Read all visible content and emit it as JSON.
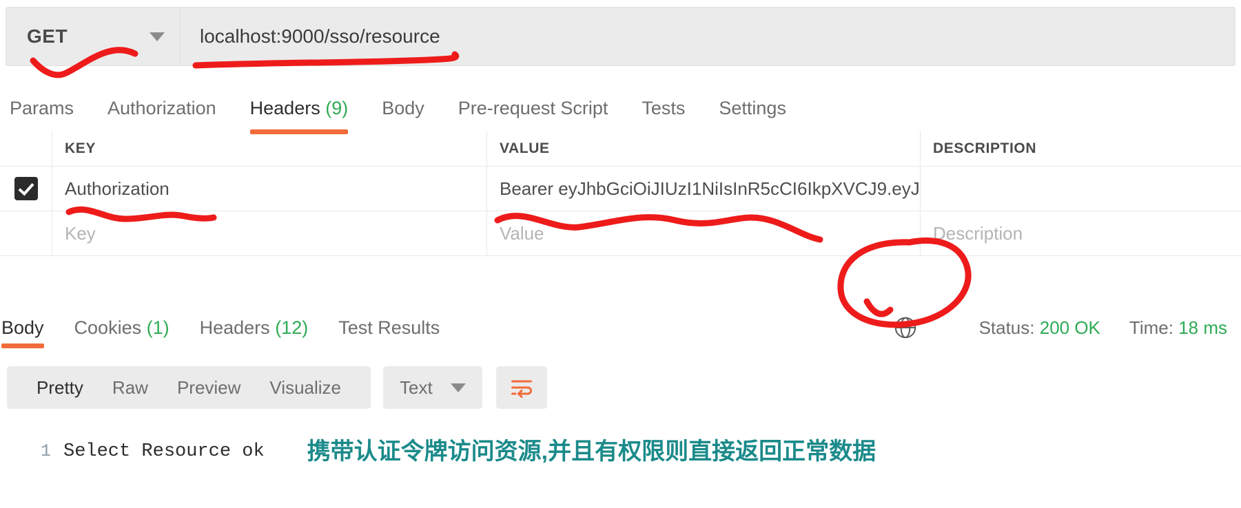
{
  "request": {
    "method": "GET",
    "url": "localhost:9000/sso/resource",
    "method_dropdown_icon": "chevron-down-icon",
    "tabs": [
      {
        "label": "Params",
        "count": "",
        "active": false
      },
      {
        "label": "Authorization",
        "count": "",
        "active": false
      },
      {
        "label": "Headers",
        "count": "(9)",
        "active": true
      },
      {
        "label": "Body",
        "count": "",
        "active": false
      },
      {
        "label": "Pre-request Script",
        "count": "",
        "active": false
      },
      {
        "label": "Tests",
        "count": "",
        "active": false
      },
      {
        "label": "Settings",
        "count": "",
        "active": false
      }
    ]
  },
  "headers_table": {
    "columns": [
      "KEY",
      "VALUE",
      "DESCRIPTION"
    ],
    "rows": [
      {
        "checked": true,
        "key": "Authorization",
        "value": "Bearer eyJhbGciOiJIUzI1NiIsInR5cCI6IkpXVCJ9.eyJ...",
        "description": ""
      }
    ],
    "placeholders": {
      "key": "Key",
      "value": "Value",
      "description": "Description"
    }
  },
  "response": {
    "tabs": [
      {
        "label": "Body",
        "count": "",
        "active": true
      },
      {
        "label": "Cookies",
        "count": "(1)",
        "active": false
      },
      {
        "label": "Headers",
        "count": "(12)",
        "active": false
      },
      {
        "label": "Test Results",
        "count": "",
        "active": false
      }
    ],
    "globe_icon": "globe-icon",
    "status_label": "Status:",
    "status_value": "200 OK",
    "time_label": "Time:",
    "time_value": "18 ms",
    "format_options": [
      {
        "label": "Pretty",
        "active": true
      },
      {
        "label": "Raw",
        "active": false
      },
      {
        "label": "Preview",
        "active": false
      },
      {
        "label": "Visualize",
        "active": false
      }
    ],
    "format_select": "Text",
    "format_select_icon": "chevron-down-icon",
    "wrap_button_icon": "wrap-lines-icon",
    "body_lines": [
      {
        "number": "1",
        "text": "Select Resource ok"
      }
    ],
    "annotation_cn": "携带认证令牌访问资源,并且有权限则直接返回正常数据"
  },
  "colors": {
    "accent_orange": "#f26b3a",
    "status_green": "#2eab55",
    "annotation_red": "#ee1b1b",
    "annotation_teal": "#1b8a8a"
  },
  "annotations": {
    "method_underline": "red-check-mark-method",
    "url_underline": "red-underline-url",
    "key_underline": "red-underline-authorization-key",
    "value_underline": "red-underline-token-value",
    "status_circle": "red-circle-status"
  }
}
